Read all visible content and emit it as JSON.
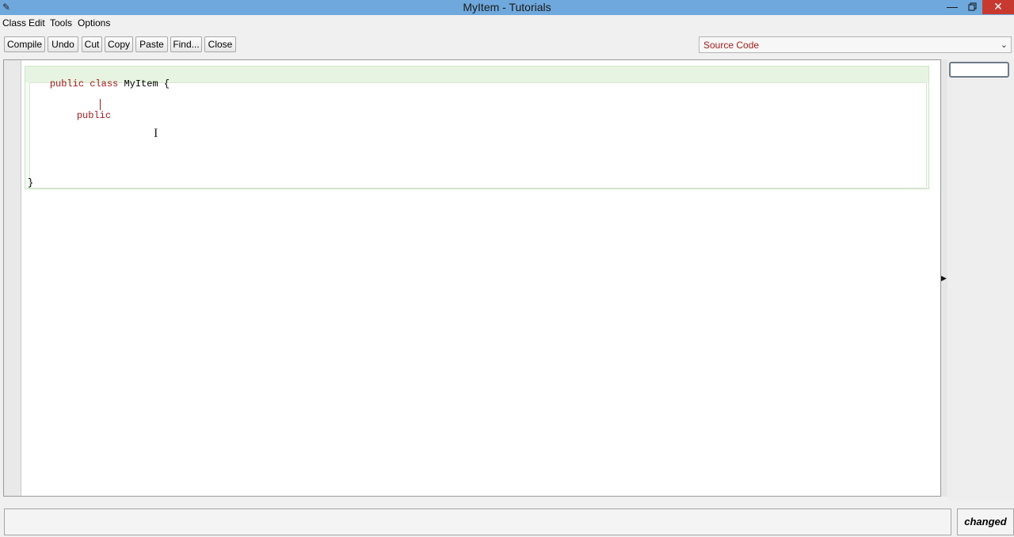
{
  "window": {
    "title": "MyItem - Tutorials",
    "icon": "bird-logo-icon",
    "controls": {
      "minimize": "—",
      "close": "✕"
    }
  },
  "menu": [
    "Class",
    "Edit",
    "Tools",
    "Options"
  ],
  "toolbar": [
    "Compile",
    "Undo",
    "Cut",
    "Copy",
    "Paste",
    "Find...",
    "Close"
  ],
  "view_select": {
    "value": "Source Code"
  },
  "editor": {
    "line1": {
      "kw1": "public",
      "kw2": "class",
      "name": "MyItem {"
    },
    "line2": {
      "kw": "public"
    },
    "line3": "}"
  },
  "status": {
    "message": "",
    "badge": "changed"
  },
  "colors": {
    "keyword": "#a01c1c",
    "scope_class": "#e6f4e1",
    "titlebar": "#6fa8dc",
    "close": "#c7392f"
  }
}
